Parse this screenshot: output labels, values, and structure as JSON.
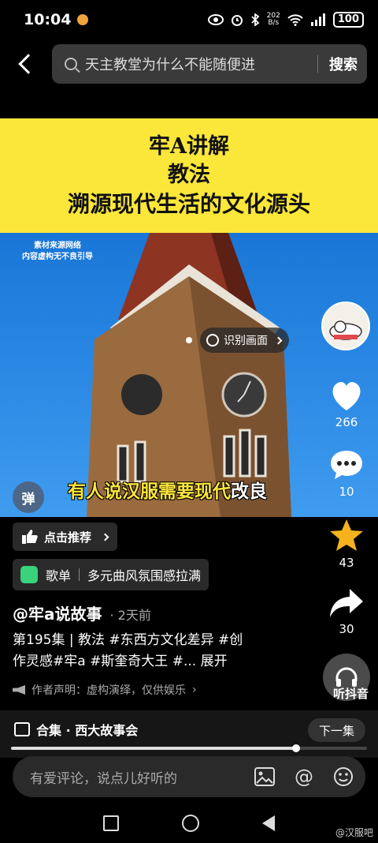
{
  "status": {
    "time": "10:04",
    "net_speed_top": "202",
    "net_speed_bottom": "B/s",
    "battery": "100"
  },
  "search": {
    "query": "天主教堂为什么不能随便进",
    "button": "搜索"
  },
  "video": {
    "banner_line1": "牢A讲解",
    "banner_line2": "教法",
    "banner_line3": "溯源现代生活的文化源头",
    "watermark_line1": "素材来源网络",
    "watermark_line2": "内容虚构无不良引导",
    "subtitle_yellow": "有人说汉服需要现代",
    "subtitle_white": "改良",
    "identify_label": "识别画面",
    "danmu": "弹"
  },
  "rail": {
    "likes": "266",
    "comments": "10",
    "favorites": "43",
    "shares": "30",
    "listen_label": "听抖音"
  },
  "info": {
    "recommend": "点击推荐",
    "playlist_tag": "歌单",
    "playlist_name": "多元曲风氛围感拉满",
    "author": "@牢a说故事",
    "posted": "· 2天前",
    "desc_line1": "第195集 | 教法 #东西方文化差异 #创",
    "desc_line2": "作灵感#牢a #斯奎奇大王 #... 展开",
    "notice": "作者声明：虚构演绎，仅供娱乐"
  },
  "collection": {
    "label": "合集 · 西大故事会",
    "next": "下一集",
    "progress": 0.8
  },
  "comment": {
    "placeholder": "有爱评论，说点儿好听的"
  },
  "watermark_brand": "@汉服吧",
  "colors": {
    "banner": "#fbe63a",
    "subtitle": "#fbe63a",
    "star": "#f5b21c"
  }
}
